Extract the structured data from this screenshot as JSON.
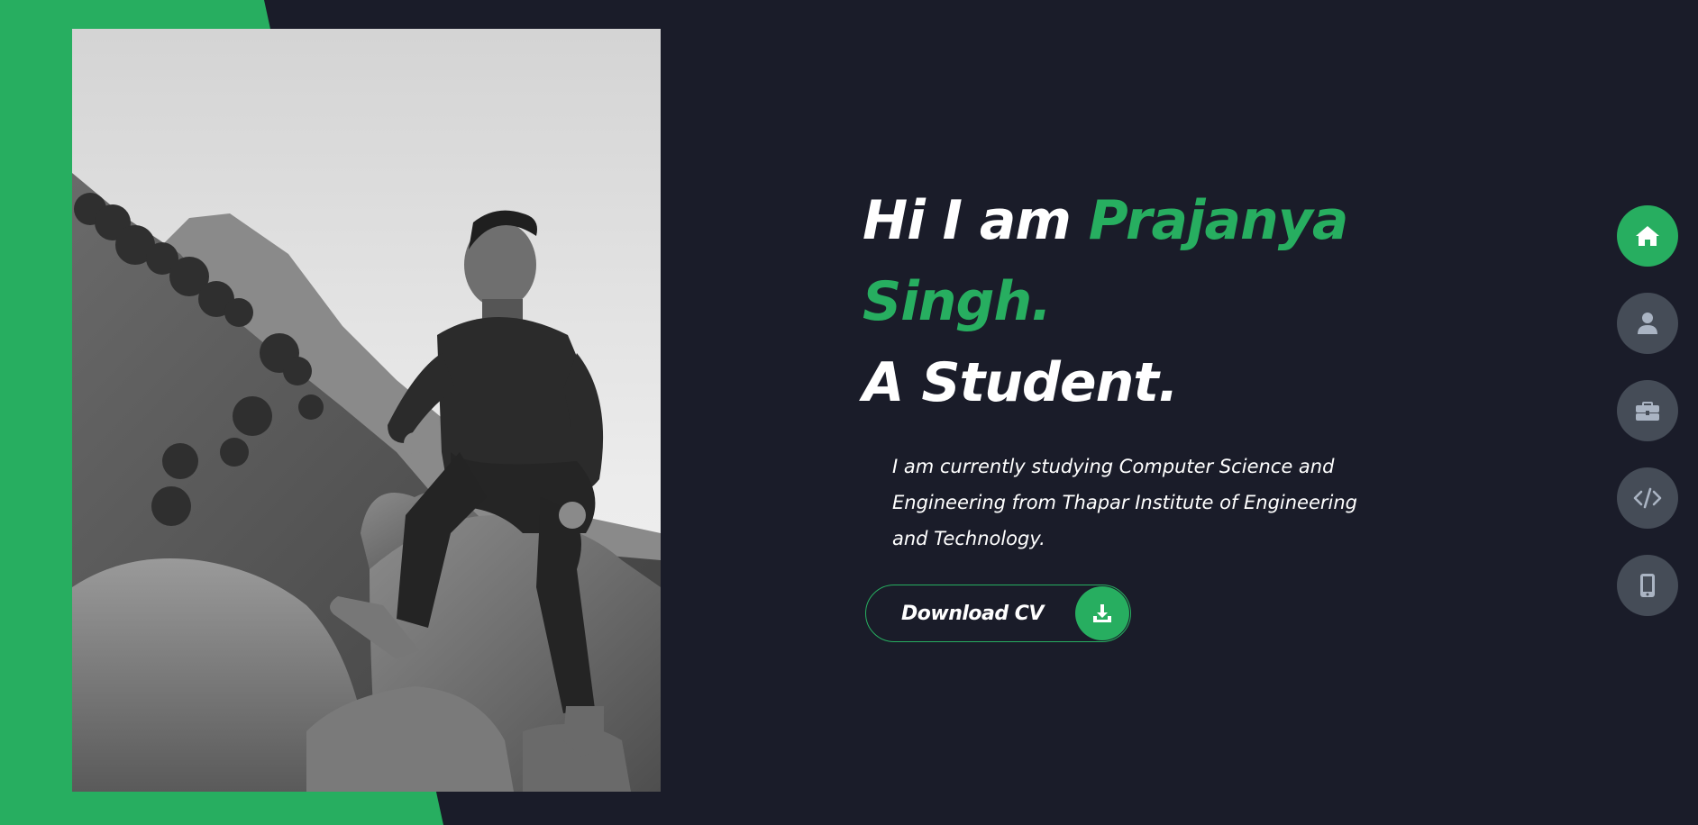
{
  "hero": {
    "greeting": "Hi I am",
    "name": "Prajanya Singh.",
    "role": "A Student.",
    "description": "I am currently studying Computer Science and Engineering from Thapar Institute of Engineering and Technology."
  },
  "cv_button": {
    "label": "Download CV",
    "icon": "download-icon"
  },
  "nav": [
    {
      "name": "home",
      "icon": "home-icon",
      "active": true
    },
    {
      "name": "about",
      "icon": "user-icon",
      "active": false
    },
    {
      "name": "portfolio",
      "icon": "briefcase-icon",
      "active": false
    },
    {
      "name": "projects",
      "icon": "code-icon",
      "active": false
    },
    {
      "name": "contact",
      "icon": "mobile-icon",
      "active": false
    }
  ],
  "colors": {
    "accent": "#27ae60",
    "background": "#1a1c29",
    "nav_inactive": "#454c57",
    "text": "#ffffff"
  },
  "photo": {
    "description_icon": "profile-photo"
  }
}
